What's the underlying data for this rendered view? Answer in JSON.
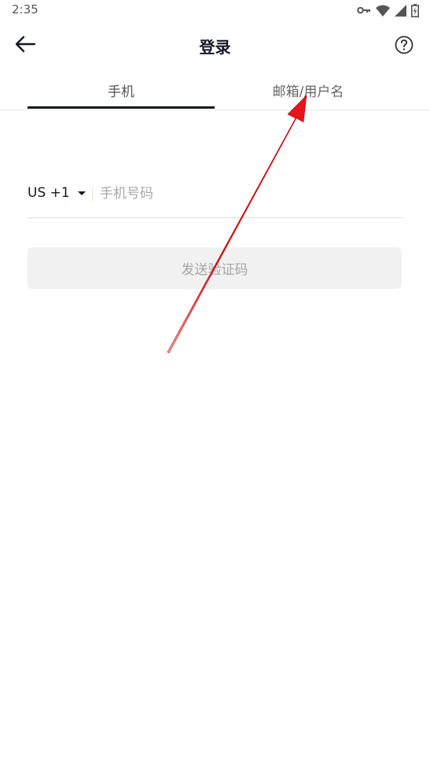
{
  "status_bar": {
    "time": "2:35",
    "icons": [
      "vpn-key-icon",
      "wifi-icon",
      "cell-signal-icon",
      "battery-icon"
    ]
  },
  "header": {
    "title": "登录",
    "back_icon": "arrow-left-icon",
    "help_icon": "help-circle-icon"
  },
  "tabs": [
    {
      "label": "手机",
      "active": true
    },
    {
      "label": "邮箱/用户名",
      "active": false
    }
  ],
  "phone_form": {
    "country_code": "US +1",
    "phone_placeholder": "手机号码",
    "phone_value": ""
  },
  "send_code_button": {
    "label": "发送验证码",
    "enabled": false
  },
  "colors": {
    "text_primary": "#161823",
    "button_bg_disabled": "#f1f1f1",
    "button_text_disabled": "#a5a5a5",
    "annotation_arrow": "#e8131b"
  }
}
